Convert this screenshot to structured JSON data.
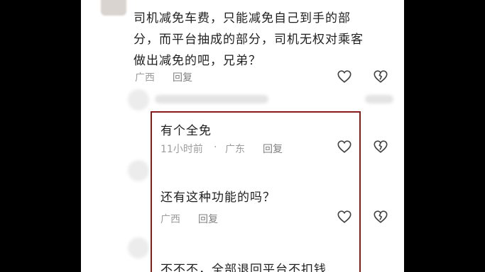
{
  "comments": [
    {
      "lines": [
        "司机减免车费，只能减免自己到手的部",
        "分，而平台抽成的部分，司机无权对乘客",
        "做出减免的吧，兄弟？"
      ],
      "location": "广西",
      "reply": "回复"
    }
  ],
  "replies": [
    {
      "text": "有个全免",
      "time": "11小时前",
      "sep": "·",
      "location": "广东",
      "reply": "回复"
    },
    {
      "text": "还有这种功能的吗？",
      "location": "广西",
      "reply": "回复"
    },
    {
      "text": "不不不，全部退回平台不扣钱"
    }
  ],
  "icons": {
    "like": "heart-outline-icon",
    "dislike": "broken-heart-icon"
  },
  "colors": {
    "highlight_border": "#8b1b1b",
    "meta_text": "#9d9d9d"
  }
}
